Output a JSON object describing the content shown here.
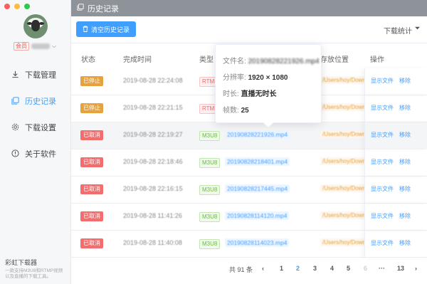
{
  "window": {
    "traffic_colors": [
      "#fc605b",
      "#fdbc40",
      "#34c84a"
    ]
  },
  "user": {
    "badge": "会员",
    "name": "某某某",
    "chevron": "⌵"
  },
  "nav": [
    {
      "label": "下载管理",
      "icon": "download-icon"
    },
    {
      "label": "历史记录",
      "icon": "history-icon"
    },
    {
      "label": "下载设置",
      "icon": "gear-icon"
    },
    {
      "label": "关于软件",
      "icon": "info-icon"
    }
  ],
  "brand": {
    "title": "彩虹下载器",
    "desc_1": "一款支持M3U8和RTMP视频",
    "desc_2": "以及直播的下载工具。"
  },
  "header": {
    "title": "历史记录"
  },
  "toolbar": {
    "clear_label": "清空历史记录",
    "stats_label": "下载统计"
  },
  "table": {
    "headers": {
      "status": "状态",
      "time": "完成时间",
      "type": "类型",
      "location": "存放位置",
      "ops": "操作"
    },
    "rows": [
      {
        "status": "已停止",
        "time": "2019-08-28 22:24:08",
        "type": "RTMP",
        "file": "",
        "location": "/Users/hoy/Downloads",
        "show": "显示文件",
        "remove": "移除"
      },
      {
        "status": "已停止",
        "time": "2019-08-28 22:21:15",
        "type": "RTMP",
        "file": "",
        "location": "/Users/hoy/Downloads",
        "show": "显示文件",
        "remove": "移除"
      },
      {
        "status": "已取消",
        "time": "2019-08-28 22:19:27",
        "type": "M3U8",
        "file": "20190828221926.mp4",
        "location": "/Users/hoy/Downloads",
        "show": "显示文件",
        "remove": "移除"
      },
      {
        "status": "已取消",
        "time": "2019-08-28 22:18:46",
        "type": "M3U8",
        "file": "20190828218401.mp4",
        "location": "/Users/hoy/Downloads",
        "show": "显示文件",
        "remove": "移除"
      },
      {
        "status": "已取消",
        "time": "2019-08-28 22:16:15",
        "type": "M3U8",
        "file": "20190828217445.mp4",
        "location": "/Users/hoy/Downloads",
        "show": "显示文件",
        "remove": "移除"
      },
      {
        "status": "已取消",
        "time": "2019-08-28 11:41:26",
        "type": "M3U8",
        "file": "20190828114120.mp4",
        "location": "/Users/hoy/Downloads",
        "show": "显示文件",
        "remove": "移除"
      },
      {
        "status": "已取消",
        "time": "2019-08-28 11:40:08",
        "type": "M3U8",
        "file": "20190828114023.mp4",
        "location": "/Users/hoy/Downloads",
        "show": "显示文件",
        "remove": "移除"
      }
    ]
  },
  "popover": {
    "filename_label": "文件名:",
    "filename": "20190828221926.mp4",
    "resolution_label": "分辨率:",
    "resolution": "1920 × 1080",
    "duration_label": "时长:",
    "duration": "直播无时长",
    "fps_label": "帧数:",
    "fps": "25"
  },
  "pagination": {
    "total": "共 91 条",
    "prev": "‹",
    "next": "›",
    "pages": [
      "1",
      "2",
      "3",
      "4",
      "5",
      "6",
      "···",
      "13"
    ],
    "current": "2"
  }
}
